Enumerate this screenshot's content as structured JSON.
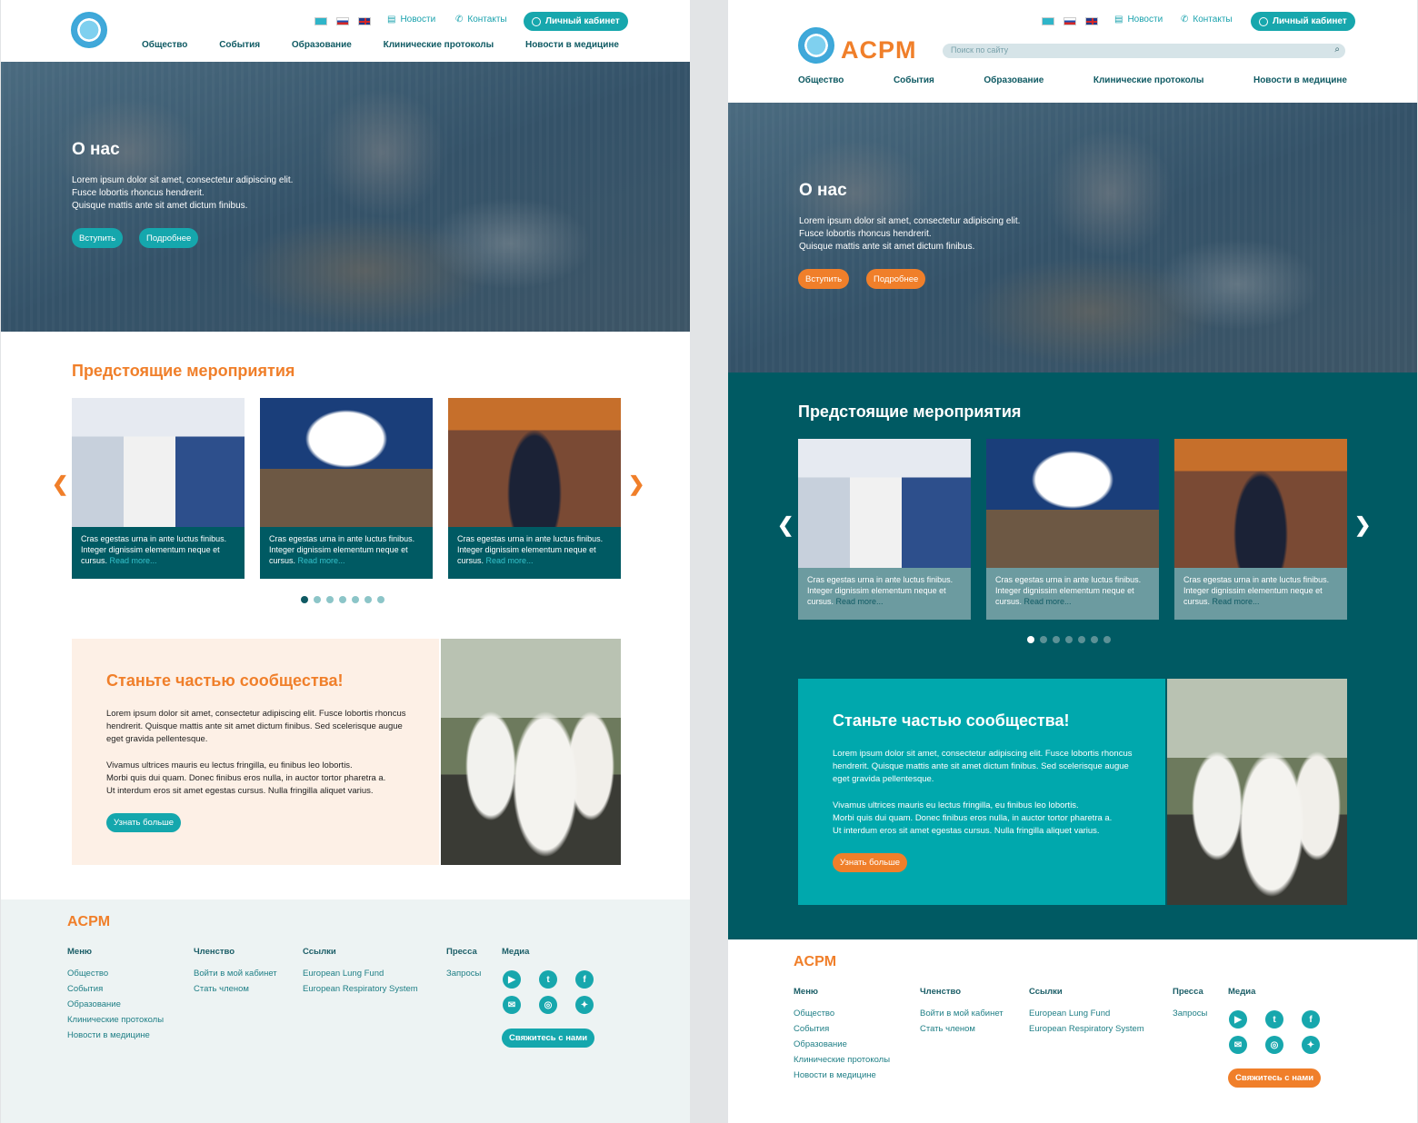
{
  "langs": [
    "kz",
    "ru",
    "en"
  ],
  "header": {
    "news": "Новости",
    "contacts": "Контакты",
    "cabinet": "Личный кабинет",
    "brand": "ACPM",
    "search_placeholder": "Поиск по сайту",
    "nav": [
      "Общество",
      "События",
      "Образование",
      "Клинические протоколы",
      "Новости в медицине"
    ]
  },
  "hero": {
    "title": "О нас",
    "lines": [
      "Lorem ipsum dolor sit amet, consectetur adipiscing elit.",
      "Fusce lobortis rhoncus hendrerit.",
      "Quisque mattis ante sit amet dictum finibus."
    ],
    "join": "Вступить",
    "more": "Подробнее"
  },
  "events": {
    "title": "Предстоящие мероприятия",
    "card_text": "Cras egestas urna in ante luctus finibus. Integer dignissim elementum neque et cursus.",
    "read_more": "Read more...",
    "dots": 7
  },
  "join_section": {
    "title": "Станьте частью сообщества!",
    "p1": "Lorem ipsum dolor sit amet, consectetur adipiscing elit. Fusce lobortis rhoncus hendrerit. Quisque mattis ante sit amet dictum finibus. Sed scelerisque augue eget gravida pellentesque.",
    "p2_lines": [
      "Vivamus ultrices mauris eu lectus fringilla, eu finibus leo lobortis.",
      "Morbi quis dui quam. Donec finibus eros nulla, in auctor tortor pharetra a.",
      "Ut interdum eros sit amet egestas cursus. Nulla fringilla aliquet varius."
    ],
    "button": "Узнать больше"
  },
  "footer": {
    "brand": "ACPM",
    "menu": {
      "title": "Меню",
      "items": [
        "Общество",
        "События",
        "Образование",
        "Клинические протоколы",
        "Новости в медицине"
      ]
    },
    "membership": {
      "title": "Членство",
      "items": [
        "Войти в мой кабинет",
        "Стать членом"
      ]
    },
    "links": {
      "title": "Ссылки",
      "items": [
        "European Lung Fund",
        "European Respiratory System"
      ]
    },
    "press": {
      "title": "Пресса",
      "items": [
        "Запросы"
      ]
    },
    "media": {
      "title": "Медиа",
      "icons": [
        "youtube-icon",
        "tumblr-icon",
        "facebook-icon",
        "messenger-icon",
        "instagram-icon",
        "twitter-icon"
      ]
    },
    "contact": "Свяжитесь с нами"
  },
  "colors": {
    "teal": "#17a7ad",
    "orange": "#f07f2a",
    "dark_teal": "#005a63",
    "peach": "#fdf0e6"
  }
}
